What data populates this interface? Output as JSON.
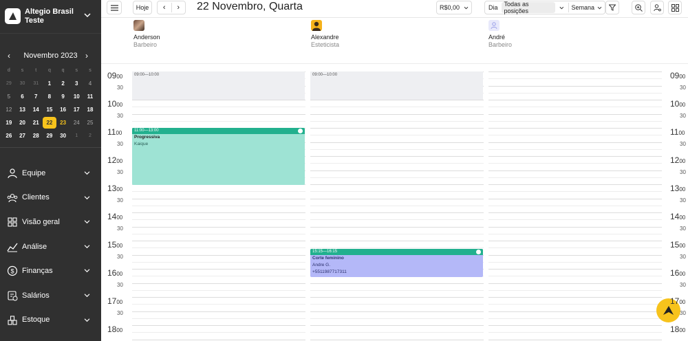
{
  "brand": {
    "name": "Altegio Brasil Teste"
  },
  "calendar": {
    "month_label": "Novembro 2023",
    "weekdays": [
      "d",
      "s",
      "t",
      "q",
      "q",
      "s",
      "s"
    ],
    "weeks": [
      [
        "29",
        "30",
        "31",
        "1",
        "2",
        "3",
        "4"
      ],
      [
        "5",
        "6",
        "7",
        "8",
        "9",
        "10",
        "11"
      ],
      [
        "12",
        "13",
        "14",
        "15",
        "16",
        "17",
        "18"
      ],
      [
        "19",
        "20",
        "21",
        "22",
        "23",
        "24",
        "25"
      ],
      [
        "26",
        "27",
        "28",
        "29",
        "30",
        "1",
        "2"
      ]
    ]
  },
  "menu": [
    {
      "label": "Equipe",
      "icon": "person-icon"
    },
    {
      "label": "Clientes",
      "icon": "people-icon"
    },
    {
      "label": "Visão geral",
      "icon": "grid-icon"
    },
    {
      "label": "Análise",
      "icon": "chart-icon"
    },
    {
      "label": "Finanças",
      "icon": "money-icon"
    },
    {
      "label": "Salários",
      "icon": "payroll-icon"
    },
    {
      "label": "Estoque",
      "icon": "box-icon"
    }
  ],
  "toolbar": {
    "today_label": "Hoje",
    "date_title": "22 Novembro, Quarta",
    "revenue": "R$0,00",
    "view_day": "Dia",
    "positions": "Todas as posições",
    "view_week": "Semana"
  },
  "staff": [
    {
      "name": "Anderson",
      "role": "Barbeiro"
    },
    {
      "name": "Alexandre",
      "role": "Esteticista"
    },
    {
      "name": "André",
      "role": "Barbeiro"
    }
  ],
  "hours": [
    "09",
    "10",
    "11",
    "12",
    "13",
    "14",
    "15",
    "16",
    "17",
    "18"
  ],
  "minute_zero": "00",
  "minute_half": "30",
  "blocked": [
    {
      "label": "09:00—10:00"
    },
    {
      "label": "09:00—10:00"
    }
  ],
  "events": [
    {
      "time": "11:00—13:00",
      "service": "Progressiva",
      "client": "Kaique",
      "phone": ""
    },
    {
      "time": "15:15—16:15",
      "service": "Corte feminino",
      "client": "Andre G.",
      "phone": "+5511987717311"
    }
  ],
  "colors": {
    "sidebar": "#303030",
    "accent": "#f7c31c",
    "event_green": "#22b08e",
    "event_teal": "#9ee3d4",
    "event_blue": "#b4b8f8"
  }
}
